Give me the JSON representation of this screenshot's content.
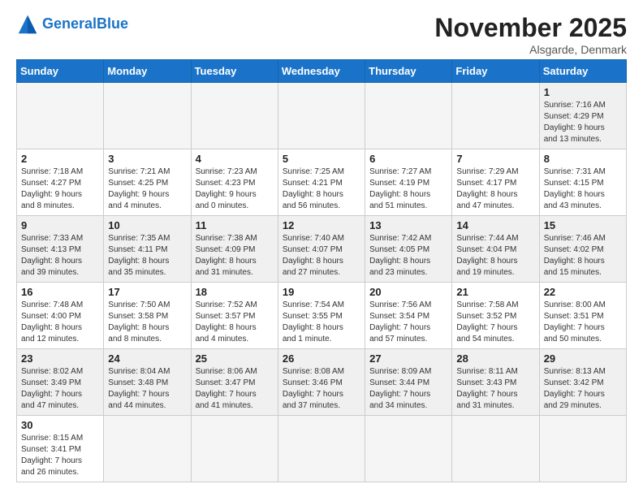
{
  "header": {
    "logo_general": "General",
    "logo_blue": "Blue",
    "month_title": "November 2025",
    "subtitle": "Alsgarde, Denmark"
  },
  "weekdays": [
    "Sunday",
    "Monday",
    "Tuesday",
    "Wednesday",
    "Thursday",
    "Friday",
    "Saturday"
  ],
  "weeks": [
    [
      {
        "day": "",
        "info": ""
      },
      {
        "day": "",
        "info": ""
      },
      {
        "day": "",
        "info": ""
      },
      {
        "day": "",
        "info": ""
      },
      {
        "day": "",
        "info": ""
      },
      {
        "day": "",
        "info": ""
      },
      {
        "day": "1",
        "info": "Sunrise: 7:16 AM\nSunset: 4:29 PM\nDaylight: 9 hours\nand 13 minutes."
      }
    ],
    [
      {
        "day": "2",
        "info": "Sunrise: 7:18 AM\nSunset: 4:27 PM\nDaylight: 9 hours\nand 8 minutes."
      },
      {
        "day": "3",
        "info": "Sunrise: 7:21 AM\nSunset: 4:25 PM\nDaylight: 9 hours\nand 4 minutes."
      },
      {
        "day": "4",
        "info": "Sunrise: 7:23 AM\nSunset: 4:23 PM\nDaylight: 9 hours\nand 0 minutes."
      },
      {
        "day": "5",
        "info": "Sunrise: 7:25 AM\nSunset: 4:21 PM\nDaylight: 8 hours\nand 56 minutes."
      },
      {
        "day": "6",
        "info": "Sunrise: 7:27 AM\nSunset: 4:19 PM\nDaylight: 8 hours\nand 51 minutes."
      },
      {
        "day": "7",
        "info": "Sunrise: 7:29 AM\nSunset: 4:17 PM\nDaylight: 8 hours\nand 47 minutes."
      },
      {
        "day": "8",
        "info": "Sunrise: 7:31 AM\nSunset: 4:15 PM\nDaylight: 8 hours\nand 43 minutes."
      }
    ],
    [
      {
        "day": "9",
        "info": "Sunrise: 7:33 AM\nSunset: 4:13 PM\nDaylight: 8 hours\nand 39 minutes."
      },
      {
        "day": "10",
        "info": "Sunrise: 7:35 AM\nSunset: 4:11 PM\nDaylight: 8 hours\nand 35 minutes."
      },
      {
        "day": "11",
        "info": "Sunrise: 7:38 AM\nSunset: 4:09 PM\nDaylight: 8 hours\nand 31 minutes."
      },
      {
        "day": "12",
        "info": "Sunrise: 7:40 AM\nSunset: 4:07 PM\nDaylight: 8 hours\nand 27 minutes."
      },
      {
        "day": "13",
        "info": "Sunrise: 7:42 AM\nSunset: 4:05 PM\nDaylight: 8 hours\nand 23 minutes."
      },
      {
        "day": "14",
        "info": "Sunrise: 7:44 AM\nSunset: 4:04 PM\nDaylight: 8 hours\nand 19 minutes."
      },
      {
        "day": "15",
        "info": "Sunrise: 7:46 AM\nSunset: 4:02 PM\nDaylight: 8 hours\nand 15 minutes."
      }
    ],
    [
      {
        "day": "16",
        "info": "Sunrise: 7:48 AM\nSunset: 4:00 PM\nDaylight: 8 hours\nand 12 minutes."
      },
      {
        "day": "17",
        "info": "Sunrise: 7:50 AM\nSunset: 3:58 PM\nDaylight: 8 hours\nand 8 minutes."
      },
      {
        "day": "18",
        "info": "Sunrise: 7:52 AM\nSunset: 3:57 PM\nDaylight: 8 hours\nand 4 minutes."
      },
      {
        "day": "19",
        "info": "Sunrise: 7:54 AM\nSunset: 3:55 PM\nDaylight: 8 hours\nand 1 minute."
      },
      {
        "day": "20",
        "info": "Sunrise: 7:56 AM\nSunset: 3:54 PM\nDaylight: 7 hours\nand 57 minutes."
      },
      {
        "day": "21",
        "info": "Sunrise: 7:58 AM\nSunset: 3:52 PM\nDaylight: 7 hours\nand 54 minutes."
      },
      {
        "day": "22",
        "info": "Sunrise: 8:00 AM\nSunset: 3:51 PM\nDaylight: 7 hours\nand 50 minutes."
      }
    ],
    [
      {
        "day": "23",
        "info": "Sunrise: 8:02 AM\nSunset: 3:49 PM\nDaylight: 7 hours\nand 47 minutes."
      },
      {
        "day": "24",
        "info": "Sunrise: 8:04 AM\nSunset: 3:48 PM\nDaylight: 7 hours\nand 44 minutes."
      },
      {
        "day": "25",
        "info": "Sunrise: 8:06 AM\nSunset: 3:47 PM\nDaylight: 7 hours\nand 41 minutes."
      },
      {
        "day": "26",
        "info": "Sunrise: 8:08 AM\nSunset: 3:46 PM\nDaylight: 7 hours\nand 37 minutes."
      },
      {
        "day": "27",
        "info": "Sunrise: 8:09 AM\nSunset: 3:44 PM\nDaylight: 7 hours\nand 34 minutes."
      },
      {
        "day": "28",
        "info": "Sunrise: 8:11 AM\nSunset: 3:43 PM\nDaylight: 7 hours\nand 31 minutes."
      },
      {
        "day": "29",
        "info": "Sunrise: 8:13 AM\nSunset: 3:42 PM\nDaylight: 7 hours\nand 29 minutes."
      }
    ],
    [
      {
        "day": "30",
        "info": "Sunrise: 8:15 AM\nSunset: 3:41 PM\nDaylight: 7 hours\nand 26 minutes."
      },
      {
        "day": "",
        "info": ""
      },
      {
        "day": "",
        "info": ""
      },
      {
        "day": "",
        "info": ""
      },
      {
        "day": "",
        "info": ""
      },
      {
        "day": "",
        "info": ""
      },
      {
        "day": "",
        "info": ""
      }
    ]
  ]
}
